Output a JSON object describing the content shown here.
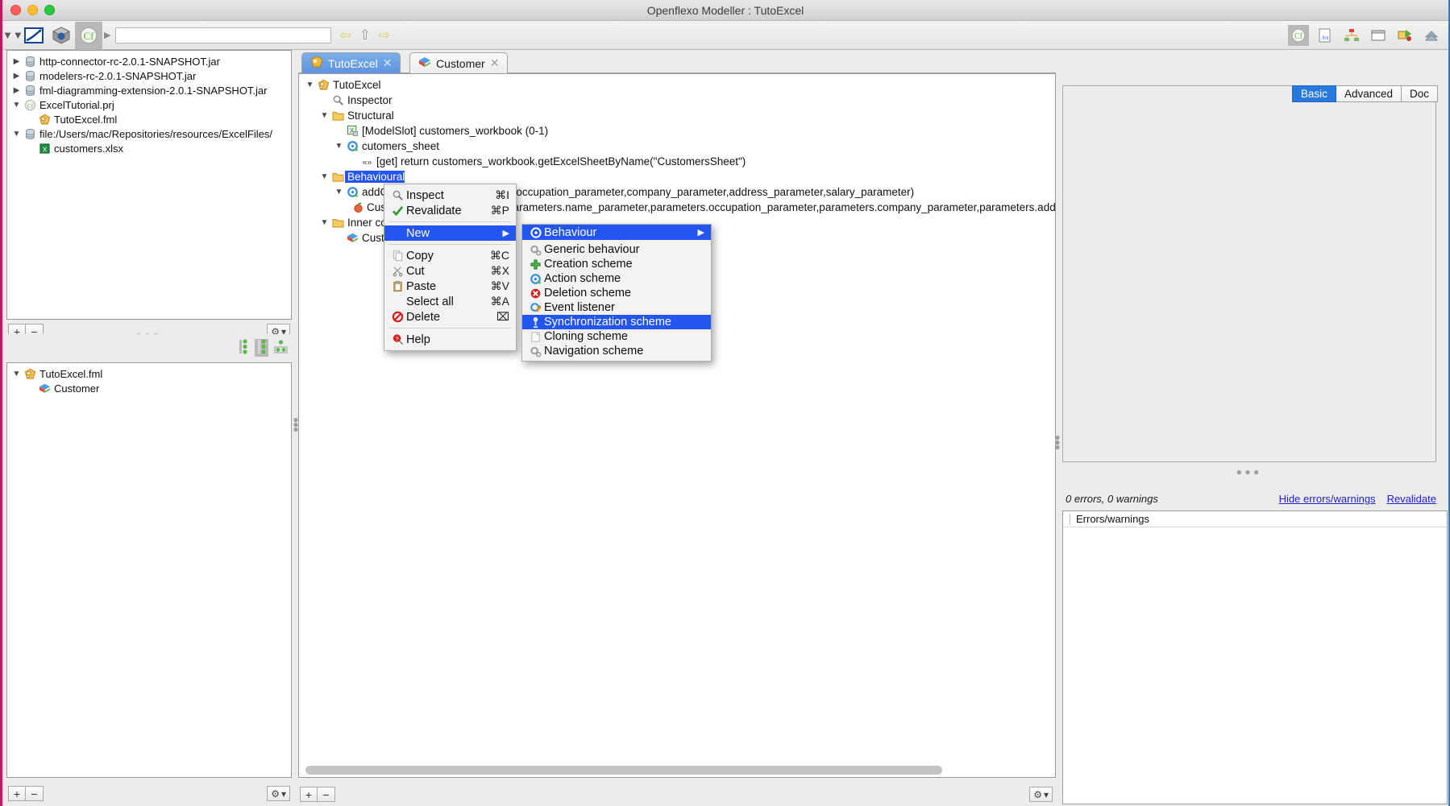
{
  "window": {
    "title": "Openflexo Modeller : TutoExcel"
  },
  "toolbar": {
    "address_value": "",
    "address_placeholder": "",
    "icons": [
      "chevrons-down-icon",
      "openflexo-logo-icon",
      "cube-icon",
      "project-icon"
    ],
    "nav_back": "back-arrow-icon",
    "nav_up": "up-arrow-icon",
    "nav_forward": "forward-arrow-icon",
    "right_icons": [
      "project-icon",
      "fml-file-icon",
      "hierarchy-icon",
      "window-icon",
      "diagram-icon",
      "collapse-icon"
    ]
  },
  "left_top_tree": {
    "items": [
      {
        "indent": 0,
        "twisty": "collapsed",
        "icon": "jar-icon",
        "label": "http-connector-rc-2.0.1-SNAPSHOT.jar"
      },
      {
        "indent": 0,
        "twisty": "collapsed",
        "icon": "jar-icon",
        "label": "modelers-rc-2.0.1-SNAPSHOT.jar"
      },
      {
        "indent": 0,
        "twisty": "collapsed",
        "icon": "jar-icon",
        "label": "fml-diagramming-extension-2.0.1-SNAPSHOT.jar"
      },
      {
        "indent": 0,
        "twisty": "expanded",
        "icon": "project-icon",
        "label": "ExcelTutorial.prj"
      },
      {
        "indent": 1,
        "twisty": "none",
        "icon": "fml-icon",
        "label": "TutoExcel.fml"
      },
      {
        "indent": 0,
        "twisty": "expanded",
        "icon": "jar-icon",
        "label": "file:/Users/mac/Repositories/resources/ExcelFiles/"
      },
      {
        "indent": 1,
        "twisty": "none",
        "icon": "xlsx-icon",
        "label": "customers.xlsx"
      }
    ]
  },
  "left_bottom_tree": {
    "items": [
      {
        "indent": 0,
        "twisty": "expanded",
        "icon": "fml-icon",
        "label": "TutoExcel.fml"
      },
      {
        "indent": 1,
        "twisty": "none",
        "icon": "concept-icon",
        "label": "Customer"
      }
    ]
  },
  "center": {
    "tabs": [
      {
        "label": "TutoExcel",
        "icon": "fml-icon",
        "active": true,
        "close": "✕"
      },
      {
        "label": "Customer",
        "icon": "concept-icon",
        "active": false,
        "close": "✕"
      }
    ],
    "tree": [
      {
        "indent": 0,
        "twisty": "expanded",
        "icon": "fml-icon",
        "label": "TutoExcel",
        "selected": false
      },
      {
        "indent": 1,
        "twisty": "none",
        "icon": "inspector-icon",
        "label": "Inspector",
        "selected": false
      },
      {
        "indent": 1,
        "twisty": "expanded",
        "icon": "folder-icon",
        "label": "Structural",
        "selected": false
      },
      {
        "indent": 2,
        "twisty": "none",
        "icon": "excel-icon",
        "label": "[ModelSlot] customers_workbook (0-1)",
        "selected": false
      },
      {
        "indent": 2,
        "twisty": "expanded",
        "icon": "action-icon",
        "label": "cutomers_sheet",
        "selected": false
      },
      {
        "indent": 3,
        "twisty": "none",
        "icon": "code-icon",
        "label": "[get] return customers_workbook.getExcelSheetByName(\"CustomersSheet\")",
        "selected": false
      },
      {
        "indent": 1,
        "twisty": "expanded",
        "icon": "folder-icon",
        "label": "Behavioural",
        "selected": true
      },
      {
        "indent": 2,
        "twisty": "expanded",
        "icon": "action-icon",
        "label": "addCustomer(name_parameter,occupation_parameter,company_parameter,address_parameter,salary_parameter)",
        "selected": false
      },
      {
        "indent": 3,
        "twisty": "none",
        "icon": "concept2-icon",
        "label": "Customer : create Customer(parameters.name_parameter,parameters.occupation_parameter,parameters.company_parameter,parameters.address_parameter,...",
        "selected": false
      },
      {
        "indent": 1,
        "twisty": "expanded",
        "icon": "folder-icon",
        "label": "Inner concepts",
        "selected": false
      },
      {
        "indent": 2,
        "twisty": "none",
        "icon": "concept-icon",
        "label": "Customer",
        "selected": false
      }
    ]
  },
  "context_menu": {
    "items": [
      {
        "type": "item",
        "icon": "inspect-icon",
        "label": "Inspect",
        "accel": "⌘I",
        "highlight": false,
        "submenu": false
      },
      {
        "type": "item",
        "icon": "revalidate-icon",
        "label": "Revalidate",
        "accel": "⌘P",
        "highlight": false,
        "submenu": false
      },
      {
        "type": "separator"
      },
      {
        "type": "item",
        "icon": "",
        "label": "New",
        "accel": "",
        "highlight": true,
        "submenu": true
      },
      {
        "type": "separator"
      },
      {
        "type": "item",
        "icon": "copy-icon",
        "label": "Copy",
        "accel": "⌘C",
        "highlight": false,
        "submenu": false
      },
      {
        "type": "item",
        "icon": "cut-icon",
        "label": "Cut",
        "accel": "⌘X",
        "highlight": false,
        "submenu": false
      },
      {
        "type": "item",
        "icon": "paste-icon",
        "label": "Paste",
        "accel": "⌘V",
        "highlight": false,
        "submenu": false
      },
      {
        "type": "item",
        "icon": "",
        "label": "Select all",
        "accel": "⌘A",
        "highlight": false,
        "submenu": false
      },
      {
        "type": "item",
        "icon": "delete-icon",
        "label": "Delete",
        "accel": "⌧",
        "highlight": false,
        "submenu": false
      },
      {
        "type": "separator"
      },
      {
        "type": "item",
        "icon": "help-icon",
        "label": "Help",
        "accel": "",
        "highlight": false,
        "submenu": false
      }
    ],
    "submenu_header": {
      "icon": "action-icon",
      "label": "Behaviour",
      "arrow": "▶"
    },
    "submenu": [
      {
        "icon": "generic-behaviour-icon",
        "label": "Generic behaviour",
        "highlight": false
      },
      {
        "icon": "creation-scheme-icon",
        "label": "Creation scheme",
        "highlight": false
      },
      {
        "icon": "action-scheme-icon",
        "label": "Action scheme",
        "highlight": false
      },
      {
        "icon": "deletion-scheme-icon",
        "label": "Deletion scheme",
        "highlight": false
      },
      {
        "icon": "event-listener-icon",
        "label": "Event listener",
        "highlight": false
      },
      {
        "icon": "synchronization-icon",
        "label": "Synchronization scheme",
        "highlight": true
      },
      {
        "icon": "cloning-scheme-icon",
        "label": "Cloning scheme",
        "highlight": false
      },
      {
        "icon": "navigation-scheme-icon",
        "label": "Navigation scheme",
        "highlight": false
      }
    ]
  },
  "right": {
    "tabs": [
      {
        "label": "Basic",
        "active": true
      },
      {
        "label": "Advanced",
        "active": false
      },
      {
        "label": "Doc",
        "active": false
      }
    ],
    "errors_count": "0 errors, 0 warnings",
    "hide_link": "Hide errors/warnings",
    "revalidate_link": "Revalidate",
    "errors_header": "Errors/warnings"
  },
  "buttons": {
    "plus": "+",
    "minus": "−",
    "gear": "⚙",
    "gear_caret": "▾"
  },
  "colors": {
    "accent_blue": "#2355f0",
    "tab_blue": "#5d93dd",
    "link_blue": "#2020d0",
    "folder": "#f5c85a"
  }
}
